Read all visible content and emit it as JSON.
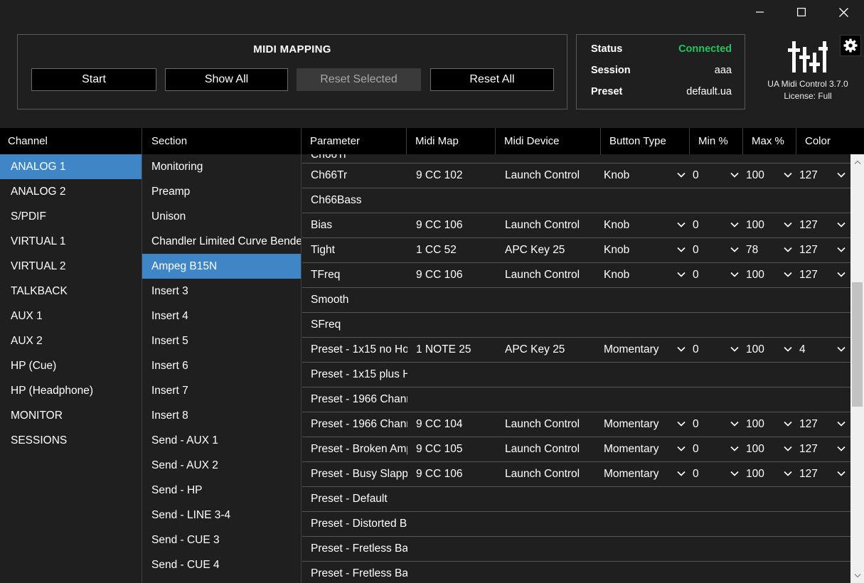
{
  "window": {
    "controls": [
      {
        "name": "minimize-button",
        "icon": "minimize-icon"
      },
      {
        "name": "maximize-button",
        "icon": "maximize-icon"
      },
      {
        "name": "close-button",
        "icon": "close-icon"
      }
    ]
  },
  "midi_mapping": {
    "title": "MIDI MAPPING",
    "buttons": {
      "start": "Start",
      "show_all": "Show All",
      "reset_selected": "Reset Selected",
      "reset_all": "Reset All"
    }
  },
  "status": {
    "status_label": "Status",
    "status_value": "Connected",
    "session_label": "Session",
    "session_value": "aaa",
    "preset_label": "Preset",
    "preset_value": "default.ua",
    "connected_color": "#22c55e"
  },
  "app": {
    "name": "UA Midi Control 3.7.0",
    "license": "License: Full",
    "settings_icon": "gear-icon",
    "logo_icon": "ua-logo-icon"
  },
  "channel": {
    "header": "Channel",
    "selected": "ANALOG 1",
    "items": [
      "ANALOG 1",
      "ANALOG 2",
      "S/PDIF",
      "VIRTUAL 1",
      "VIRTUAL 2",
      "TALKBACK",
      "AUX 1",
      "AUX 2",
      "HP (Cue)",
      "HP (Headphone)",
      "MONITOR",
      "SESSIONS"
    ]
  },
  "section": {
    "header": "Section",
    "selected": "Ampeg B15N",
    "items": [
      "Monitoring",
      "Preamp",
      "Unison",
      "Chandler Limited Curve Bende",
      "Ampeg B15N",
      "Insert 3",
      "Insert 4",
      "Insert 5",
      "Insert 6",
      "Insert 7",
      "Insert 8",
      "Send - AUX 1",
      "Send - AUX 2",
      "Send - HP",
      "Send - LINE 3-4",
      "Send - CUE 3",
      "Send - CUE 4"
    ]
  },
  "grid": {
    "headers": {
      "parameter": "Parameter",
      "midi_map": "Midi Map",
      "midi_device": "Midi Device",
      "button_type": "Button Type",
      "min": "Min %",
      "max": "Max %",
      "color": "Color"
    },
    "partial_top_row": "Ch66Tr",
    "rows": [
      {
        "param": "Ch66Tr",
        "map": "9 CC 102",
        "device": "Launch Control",
        "btype": "Knob",
        "min": "0",
        "max": "100",
        "color": "127"
      },
      {
        "param": "Ch66Bass",
        "map": "",
        "device": "",
        "btype": "",
        "min": "",
        "max": "",
        "color": ""
      },
      {
        "param": "Bias",
        "map": "9 CC 106",
        "device": "Launch Control",
        "btype": "Knob",
        "min": "0",
        "max": "100",
        "color": "127"
      },
      {
        "param": "Tight",
        "map": "1 CC 52",
        "device": "APC Key 25",
        "btype": "Knob",
        "min": "0",
        "max": "78",
        "color": "127"
      },
      {
        "param": "TFreq",
        "map": "9 CC 106",
        "device": "Launch Control",
        "btype": "Knob",
        "min": "0",
        "max": "100",
        "color": "127"
      },
      {
        "param": "Smooth",
        "map": "",
        "device": "",
        "btype": "",
        "min": "",
        "max": "",
        "color": ""
      },
      {
        "param": "SFreq",
        "map": "",
        "device": "",
        "btype": "",
        "min": "",
        "max": "",
        "color": ""
      },
      {
        "param": "Preset - 1x15 no Ho",
        "map": "1 NOTE 25",
        "device": "APC Key 25",
        "btype": "Momentary",
        "min": "0",
        "max": "100",
        "color": "4"
      },
      {
        "param": "Preset - 1x15 plus H",
        "map": "",
        "device": "",
        "btype": "",
        "min": "",
        "max": "",
        "color": ""
      },
      {
        "param": "Preset - 1966 Chanr",
        "map": "",
        "device": "",
        "btype": "",
        "min": "",
        "max": "",
        "color": ""
      },
      {
        "param": "Preset - 1966 Chanr",
        "map": "9 CC 104",
        "device": "Launch Control",
        "btype": "Momentary",
        "min": "0",
        "max": "100",
        "color": "127"
      },
      {
        "param": "Preset - Broken Amp",
        "map": "9 CC 105",
        "device": "Launch Control",
        "btype": "Momentary",
        "min": "0",
        "max": "100",
        "color": "127"
      },
      {
        "param": "Preset - Busy Slappe",
        "map": "9 CC 106",
        "device": "Launch Control",
        "btype": "Momentary",
        "min": "0",
        "max": "100",
        "color": "127"
      },
      {
        "param": "Preset - Default",
        "map": "",
        "device": "",
        "btype": "",
        "min": "",
        "max": "",
        "color": ""
      },
      {
        "param": "Preset - Distorted B.",
        "map": "",
        "device": "",
        "btype": "",
        "min": "",
        "max": "",
        "color": ""
      },
      {
        "param": "Preset - Fretless Bas",
        "map": "",
        "device": "",
        "btype": "",
        "min": "",
        "max": "",
        "color": ""
      },
      {
        "param": "Preset - Fretless Bas",
        "map": "",
        "device": "",
        "btype": "",
        "min": "",
        "max": "",
        "color": ""
      }
    ]
  },
  "colors": {
    "background": "#1f1f1f",
    "header_bg": "#000000",
    "selection": "#3f86c6",
    "row_border": "#555555"
  }
}
